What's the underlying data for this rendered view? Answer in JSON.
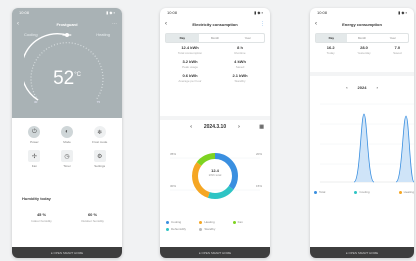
{
  "phone1": {
    "status_time": "10:08",
    "status_icons": "▮ ◆ ▪",
    "title": "Frostguard",
    "mode_tabs": [
      {
        "label": "Cooling"
      },
      {
        "label": "Auto"
      },
      {
        "label": "Heating"
      }
    ],
    "active_mode_index": 1,
    "temperature": "52",
    "temperature_unit": "°C",
    "dial_min": "30",
    "dial_max": "75",
    "controls": [
      {
        "label": "Power",
        "icon": "power-icon",
        "glyph": "⏻"
      },
      {
        "label": "Mode",
        "icon": "mode-icon",
        "glyph": "◐"
      },
      {
        "label": "Frost mode",
        "icon": "snowflake-icon",
        "glyph": "❄"
      },
      {
        "label": "Fan",
        "icon": "fan-icon",
        "glyph": "✢"
      },
      {
        "label": "Timer",
        "icon": "timer-icon",
        "glyph": "◷"
      },
      {
        "label": "Settings",
        "icon": "gear-icon",
        "glyph": "⚙"
      }
    ],
    "humidity": {
      "title": "Humidity today",
      "values": [
        {
          "value": "45 %",
          "label": "Indoor humidity"
        },
        {
          "value": "60 %",
          "label": "Outdoor humidity"
        }
      ]
    },
    "nav_text": "● OPEN SMART HOME"
  },
  "phone2": {
    "status_time": "10:08",
    "status_icons": "▮ ◆ ▪",
    "title": "Electricity consumption",
    "range_tabs": [
      "Day",
      "Month",
      "Year"
    ],
    "active_range_index": 0,
    "kpis": [
      {
        "value": "12.4 kWh",
        "label": "Total consumption"
      },
      {
        "value": "8 h",
        "label": "Runtime"
      },
      {
        "value": "3.2 kWh",
        "label": "Peak usage"
      },
      {
        "value": "4 kWh",
        "label": "Saved"
      },
      {
        "value": "0.6 kWh",
        "label": "Average per hour"
      },
      {
        "value": "2.1 kWh",
        "label": "Standby"
      }
    ],
    "period": "2024.3.10",
    "side_labels": [
      "35%",
      "20%",
      "30%",
      "15%"
    ],
    "donut_center": {
      "value": "12.4",
      "label": "kWh total"
    },
    "legend": [
      {
        "label": "Cooling",
        "color": "#3a8fe0"
      },
      {
        "label": "Heating",
        "color": "#f5a623"
      },
      {
        "label": "Fan",
        "color": "#7ed321"
      },
      {
        "label": "Dehumidify",
        "color": "#2ec4c4"
      },
      {
        "label": "Standby",
        "color": "#bbbbbb"
      }
    ],
    "nav_text": "● OPEN SMART HOME"
  },
  "phone3": {
    "status_time": "10:08",
    "status_icons": "▮ ◆ ▪",
    "title": "Energy consumption",
    "range_tabs": [
      "Day",
      "Month",
      "Year"
    ],
    "active_range_index": 0,
    "kpis": [
      {
        "value": "16.2",
        "label": "Today"
      },
      {
        "value": "28.0",
        "label": "Yesterday"
      },
      {
        "value": "7.0",
        "label": "Saved"
      }
    ],
    "period": "2024",
    "legend": [
      {
        "label": "Total",
        "color": "#3a8fe0"
      },
      {
        "label": "Cooling",
        "color": "#2ec4c4"
      },
      {
        "label": "Heating",
        "color": "#f5a623"
      }
    ],
    "nav_text": "● OPEN SMART HOME"
  }
}
